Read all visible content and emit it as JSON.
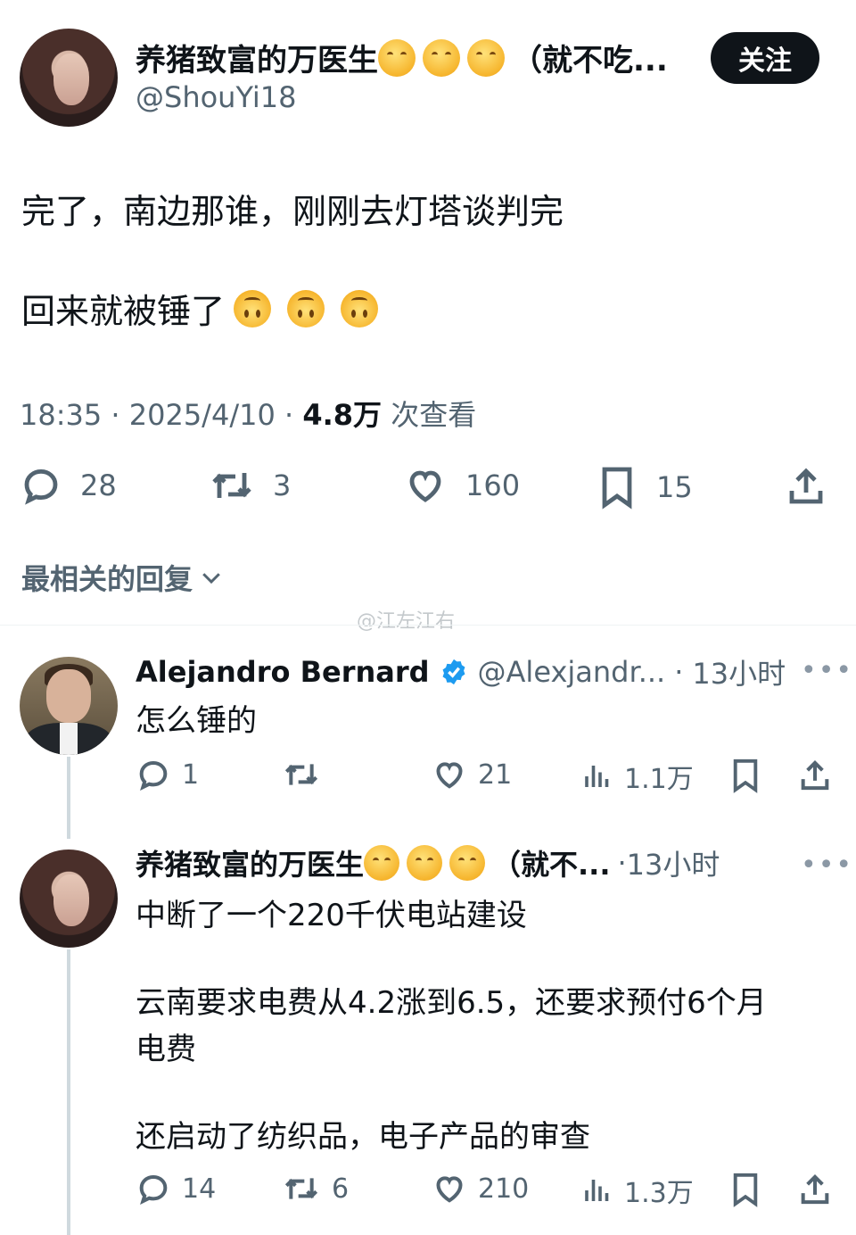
{
  "post": {
    "display_name": "养猪致富的万医生",
    "name_suffix": "（就不吃...",
    "handle": "@ShouYi18",
    "follow_label": "关注",
    "text_line1": "完了，南边那谁，刚刚去灯塔谈判完",
    "text_line2": "回来就被锤了",
    "time": "18:35",
    "date": "2025/4/10",
    "views_count": "4.8万",
    "views_label": "次查看",
    "separator": "·",
    "stats": {
      "replies": "28",
      "retweets": "3",
      "likes": "160",
      "bookmarks": "15"
    }
  },
  "replies_header": "最相关的回复",
  "watermark": "@江左江右",
  "replies": [
    {
      "name": "Alejandro Bernard",
      "handle": "@Alexjandr...",
      "time": "13小时",
      "text": "怎么锤的",
      "stats": {
        "replies": "1",
        "retweets": "",
        "likes": "21",
        "views": "1.1万"
      }
    },
    {
      "name": "养猪致富的万医生",
      "name_suffix": "（就不...",
      "time": "13小时",
      "text_line1": "中断了一个220千伏电站建设",
      "text_line2": "云南要求电费从4.2涨到6.5，还要求预付6个月",
      "text_line3": "电费",
      "text_line4": "还启动了纺织品，电子产品的审查",
      "stats": {
        "replies": "14",
        "retweets": "6",
        "likes": "210",
        "views": "1.3万"
      }
    }
  ],
  "colors": {
    "text": "#0f1419",
    "secondary": "#536471",
    "verified": "#1d9bf0",
    "follow_bg": "#0f1419"
  },
  "icons": [
    "reply-icon",
    "retweet-icon",
    "like-icon",
    "bookmark-icon",
    "share-icon",
    "views-icon",
    "verified-icon",
    "more-icon",
    "chevron-down-icon"
  ]
}
